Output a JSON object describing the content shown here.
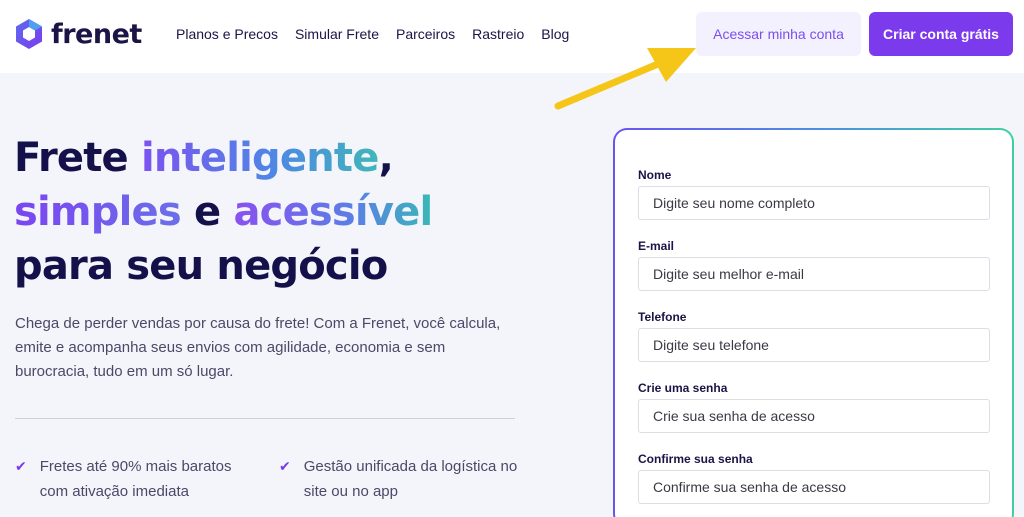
{
  "brand": {
    "name": "frenet"
  },
  "nav": {
    "items": [
      "Planos e Precos",
      "Simular Frete",
      "Parceiros",
      "Rastreio",
      "Blog"
    ],
    "login_label": "Acessar minha conta",
    "signup_label": "Criar conta grátis"
  },
  "hero": {
    "line1_a": "Frete ",
    "line1_b": "inteligente",
    "line1_c": ",",
    "line2_a": "simples",
    "line2_b": " e ",
    "line2_c": "acessível",
    "line3": "para seu negócio",
    "description": "Chega de perder vendas por causa do frete! Com a Frenet, você calcula, emite e acompanha seus envios com agilidade, economia e sem burocracia, tudo em um só lugar."
  },
  "features": [
    {
      "text": "Fretes até 90% mais baratos com ativação imediata",
      "icon": "check-icon"
    },
    {
      "text": "Gestão unificada da logística no site ou no app",
      "icon": "check-icon"
    }
  ],
  "form": {
    "fields": [
      {
        "label": "Nome",
        "placeholder": "Digite seu nome completo"
      },
      {
        "label": "E-mail",
        "placeholder": "Digite seu melhor e-mail"
      },
      {
        "label": "Telefone",
        "placeholder": "Digite seu telefone"
      },
      {
        "label": "Crie uma senha",
        "placeholder": "Crie sua senha de acesso"
      },
      {
        "label": "Confirme sua senha",
        "placeholder": "Confirme sua senha de acesso"
      }
    ]
  },
  "colors": {
    "accent": "#7c3aed",
    "brand_dark": "#1b1446",
    "arrow": "#f5c518"
  }
}
